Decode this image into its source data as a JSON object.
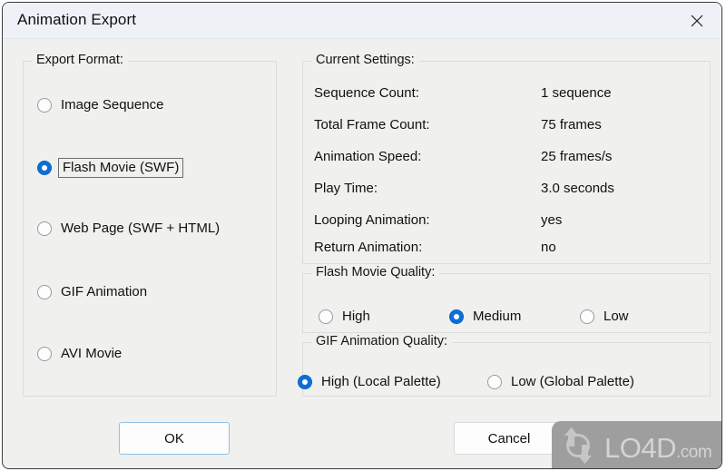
{
  "window": {
    "title": "Animation Export",
    "close_icon": "close-icon"
  },
  "export_format": {
    "legend": "Export Format:",
    "selected": "Flash Movie (SWF)",
    "options": [
      {
        "label": "Image Sequence",
        "checked": false
      },
      {
        "label": "Flash Movie (SWF)",
        "checked": true
      },
      {
        "label": "Web Page (SWF + HTML)",
        "checked": false
      },
      {
        "label": "GIF Animation",
        "checked": false
      },
      {
        "label": "AVI Movie",
        "checked": false
      }
    ]
  },
  "current_settings": {
    "legend": "Current Settings:",
    "rows": [
      {
        "label": "Sequence Count:",
        "value": "1 sequence"
      },
      {
        "label": "Total Frame Count:",
        "value": "75 frames"
      },
      {
        "label": "Animation Speed:",
        "value": "25 frames/s"
      },
      {
        "label": "Play Time:",
        "value": "3.0 seconds"
      },
      {
        "label": "Looping Animation:",
        "value": "yes"
      },
      {
        "label": "Return Animation:",
        "value": "no"
      }
    ]
  },
  "flash_movie_quality": {
    "legend": "Flash Movie Quality:",
    "selected": "Medium",
    "options": [
      {
        "label": "High",
        "checked": false
      },
      {
        "label": "Medium",
        "checked": true
      },
      {
        "label": "Low",
        "checked": false
      }
    ]
  },
  "gif_animation_quality": {
    "legend": "GIF Animation Quality:",
    "selected": "High (Local Palette)",
    "options": [
      {
        "label": "High (Local Palette)",
        "checked": true
      },
      {
        "label": "Low (Global Palette)",
        "checked": false
      }
    ]
  },
  "footer": {
    "ok_label": "OK",
    "cancel_label": "Cancel"
  },
  "watermark": {
    "text": "LO4D",
    "tld": ".com",
    "icon": "circular-arrows-icon"
  },
  "colors": {
    "accent": "#0d6fd6",
    "default_button_border": "#8fc0e8",
    "titlebar_bg": "#eef2f7",
    "dialog_bg": "#f0f0ee",
    "groupbox_border": "#dcdcdc",
    "watermark_bg": "#9e9e9e"
  }
}
